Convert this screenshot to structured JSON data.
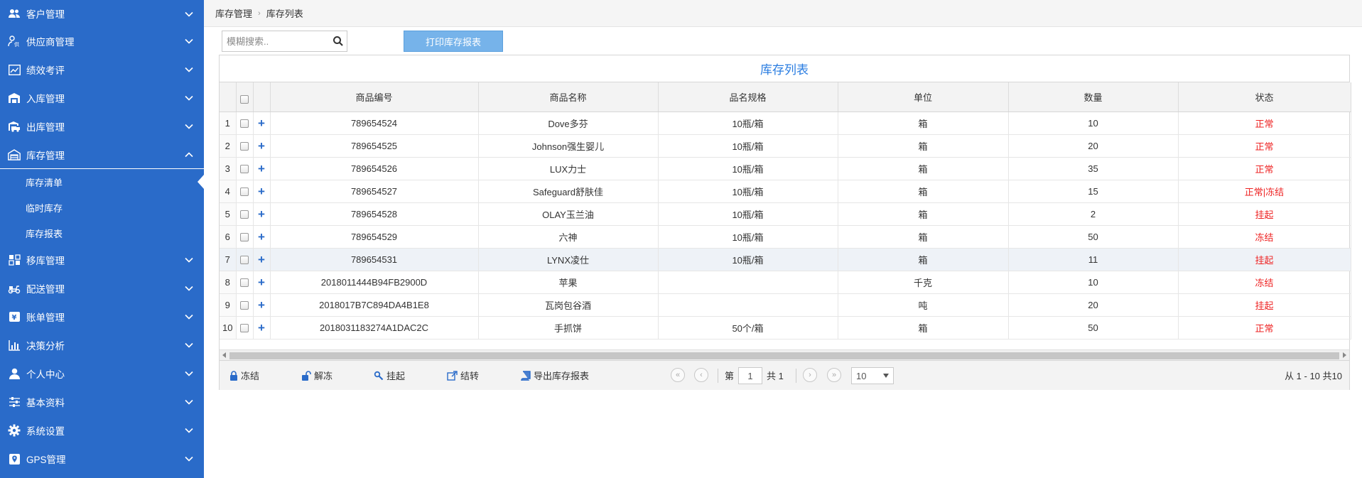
{
  "sidebar": {
    "items": [
      {
        "label": "客户管理"
      },
      {
        "label": "供应商管理"
      },
      {
        "label": "绩效考评"
      },
      {
        "label": "入库管理"
      },
      {
        "label": "出库管理"
      },
      {
        "label": "库存管理"
      },
      {
        "label": "移库管理"
      },
      {
        "label": "配送管理"
      },
      {
        "label": "账单管理"
      },
      {
        "label": "决策分析"
      },
      {
        "label": "个人中心"
      },
      {
        "label": "基本资料"
      },
      {
        "label": "系统设置"
      },
      {
        "label": "GPS管理"
      }
    ],
    "submenu": [
      {
        "label": "库存清单"
      },
      {
        "label": "临时库存"
      },
      {
        "label": "库存报表"
      }
    ]
  },
  "breadcrumb": {
    "parent": "库存管理",
    "separator": "›",
    "current": "库存列表"
  },
  "toolbar": {
    "search_placeholder": "模糊搜索..",
    "print_label": "打印库存报表"
  },
  "grid": {
    "title": "库存列表",
    "columns": [
      "商品编号",
      "商品名称",
      "品名规格",
      "单位",
      "数量",
      "状态"
    ],
    "rows": [
      {
        "num": "1",
        "code": "789654524",
        "name": "Dove多芬",
        "spec": "10瓶/箱",
        "unit": "箱",
        "qty": "10",
        "status": "正常"
      },
      {
        "num": "2",
        "code": "789654525",
        "name": "Johnson强生婴儿",
        "spec": "10瓶/箱",
        "unit": "箱",
        "qty": "20",
        "status": "正常"
      },
      {
        "num": "3",
        "code": "789654526",
        "name": "LUX力士",
        "spec": "10瓶/箱",
        "unit": "箱",
        "qty": "35",
        "status": "正常"
      },
      {
        "num": "4",
        "code": "789654527",
        "name": "Safeguard舒肤佳",
        "spec": "10瓶/箱",
        "unit": "箱",
        "qty": "15",
        "status": "正常|冻结"
      },
      {
        "num": "5",
        "code": "789654528",
        "name": "OLAY玉兰油",
        "spec": "10瓶/箱",
        "unit": "箱",
        "qty": "2",
        "status": "挂起"
      },
      {
        "num": "6",
        "code": "789654529",
        "name": "六神",
        "spec": "10瓶/箱",
        "unit": "箱",
        "qty": "50",
        "status": "冻结"
      },
      {
        "num": "7",
        "code": "789654531",
        "name": "LYNX凌仕",
        "spec": "10瓶/箱",
        "unit": "箱",
        "qty": "11",
        "status": "挂起"
      },
      {
        "num": "8",
        "code": "2018011444B94FB2900D",
        "name": "苹果",
        "spec": "",
        "unit": "千克",
        "qty": "10",
        "status": "冻结"
      },
      {
        "num": "9",
        "code": "2018017B7C894DA4B1E8",
        "name": "瓦岗包谷酒",
        "spec": "",
        "unit": "吨",
        "qty": "20",
        "status": "挂起"
      },
      {
        "num": "10",
        "code": "2018031183274A1DAC2C",
        "name": "手抓饼",
        "spec": "50个/箱",
        "unit": "箱",
        "qty": "50",
        "status": "正常"
      }
    ]
  },
  "pager": {
    "freeze": "冻结",
    "unfreeze": "解冻",
    "suspend": "挂起",
    "carry": "结转",
    "export": "导出库存报表",
    "page_prefix": "第",
    "page_value": "1",
    "page_total": "共 1",
    "page_size": "10",
    "summary": "从 1 - 10 共10"
  },
  "colors": {
    "sidebar": "#2a6bc9",
    "accent": "#2a7de1",
    "status": "#ee2222",
    "print_button": "#76b3ea"
  }
}
